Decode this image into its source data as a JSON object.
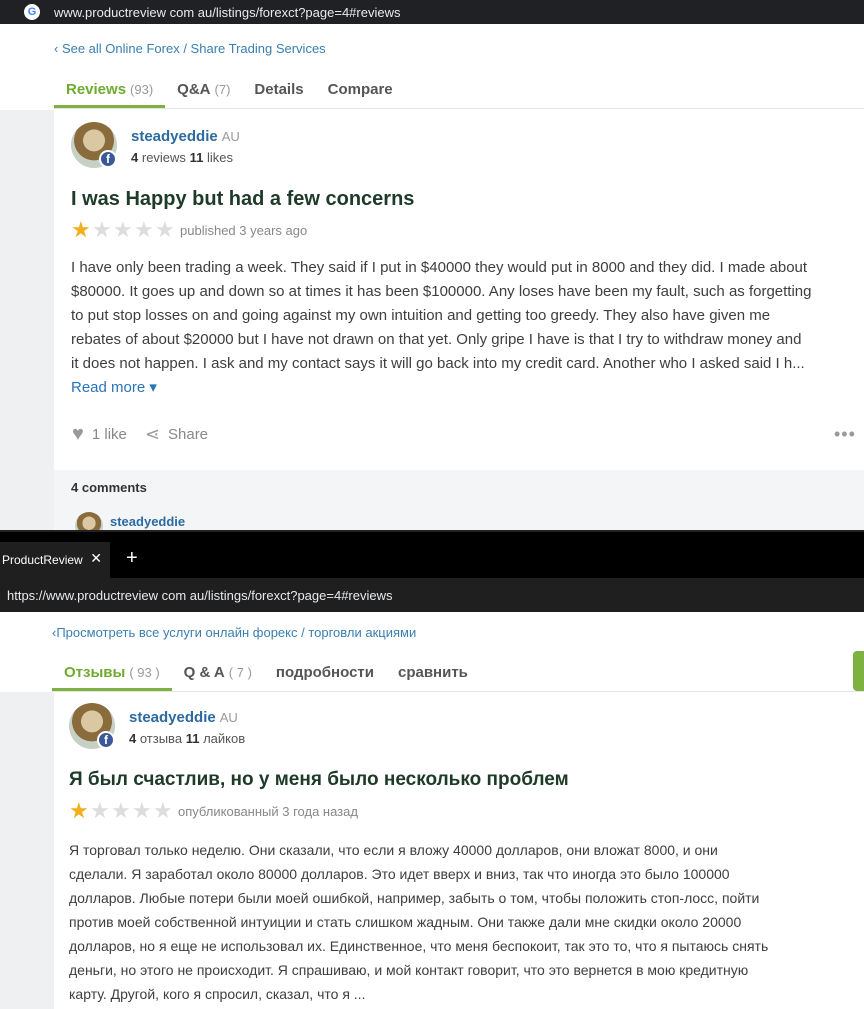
{
  "top": {
    "url": "www.productreview com au/listings/forexct?page=4#reviews",
    "breadcrumb": "‹ See all Online Forex / Share Trading Services",
    "tabs": [
      {
        "label": "Reviews",
        "count": "(93)"
      },
      {
        "label": "Q&A",
        "count": "(7)"
      },
      {
        "label": "Details",
        "count": ""
      },
      {
        "label": "Compare",
        "count": ""
      }
    ],
    "user": {
      "name": "steadyeddie",
      "country": "AU",
      "reviews_num": "4",
      "reviews_label": "reviews",
      "likes_num": "11",
      "likes_label": "likes"
    },
    "review": {
      "title": "I was Happy but had a few concerns",
      "rating": 1,
      "published": "published 3 years ago",
      "lines": [
        "I have only been trading a week. They said if I put in $40000 they would put in 8000 and they did. I made about",
        "$80000. It goes up and down so at times it has been $100000. Any loses have been my fault, such as forgetting",
        "to put stop losses on and going against my own intuition and getting too greedy. They also have given me",
        "rebates of about $20000 but I have not drawn on that yet. Only gripe I have is that I try to withdraw money and",
        "it does not happen. I ask and my contact says it will go back into my credit card. Another who I asked said I h..."
      ],
      "read_more": "Read more ▾",
      "like_label": "1 like",
      "share_label": "Share",
      "more": "•••"
    },
    "comments": {
      "count_label": "4 comments",
      "first_commenter": "steadyeddie"
    }
  },
  "bottom": {
    "tab_title": "ProductReview",
    "tab_close": "✕",
    "new_tab": "+",
    "url": "https://www.productreview com au/listings/forexct?page=4#reviews",
    "breadcrumb": "‹Просмотреть все услуги онлайн форекс / торговли акциями",
    "tabs": [
      {
        "label": "Отзывы",
        "count": "( 93 )"
      },
      {
        "label": "Q & A",
        "count": "( 7 )"
      },
      {
        "label": "подробности",
        "count": ""
      },
      {
        "label": "сравнить",
        "count": ""
      }
    ],
    "user": {
      "name": "steadyeddie",
      "country": "AU",
      "reviews_num": "4",
      "reviews_label": "отзыва",
      "likes_num": "11",
      "likes_label": "лайков"
    },
    "review": {
      "title": "Я был счастлив, но у меня было несколько проблем",
      "rating": 1,
      "published": "опубликованный 3 года назад",
      "lines": [
        "Я торговал только неделю. Они сказали, что если я вложу 40000 долларов, они вложат 8000, и они",
        "сделали. Я заработал около 80000 долларов. Это идет вверх и вниз, так что иногда это было 100000",
        "долларов. Любые потери были моей ошибкой, например, забыть о том, чтобы положить стоп-лосс, пойти",
        "против моей собственной интуиции и стать слишком жадным. Они также дали мне скидки около 20000",
        "долларов, но я еще не использовал их. Единственное, что меня беспокоит, так это то, что я пытаюсь снять",
        "деньги, но этого не происходит. Я спрашиваю, и мой контакт говорит, что это вернется в мою кредитную",
        "карту. Другой, кого я спросил, сказал, что я ..."
      ]
    }
  },
  "colors": {
    "accent_green": "#7db240",
    "link_blue": "#2c6aa0",
    "star_gold": "#f2b01e",
    "facebook": "#3b5998"
  },
  "icons": {
    "browser": "google-g-icon",
    "facebook": "facebook-icon",
    "like": "heart-icon",
    "share": "share-icon",
    "more": "more-dots-icon"
  }
}
